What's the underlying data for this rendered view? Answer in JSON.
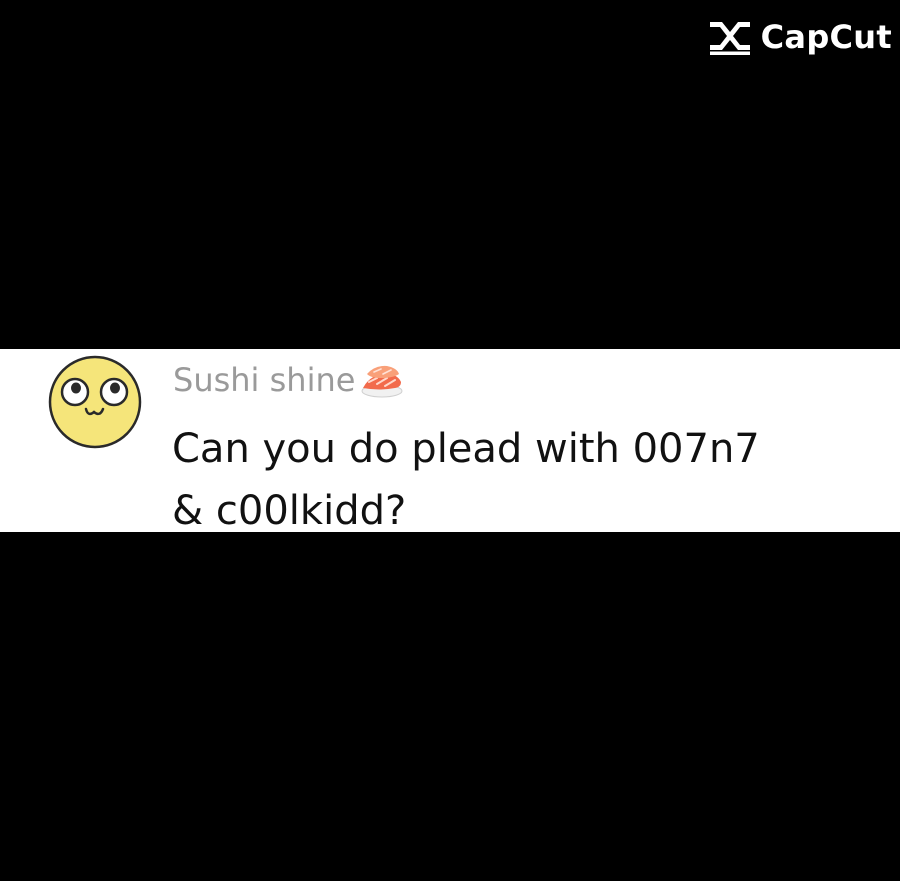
{
  "watermark": {
    "text": "CapCut",
    "icon": "capcut-logo-icon"
  },
  "comment": {
    "username": "Sushi shine",
    "username_emoji": "sushi-icon",
    "text_lines": [
      "Can you do plead with 007n7",
      "& c00lkidd?"
    ],
    "avatar": "smiley-face-avatar"
  },
  "colors": {
    "background": "#000000",
    "band": "#ffffff",
    "username": "#9a9a9a",
    "text": "#111111",
    "avatar_fill": "#f5e57a"
  }
}
